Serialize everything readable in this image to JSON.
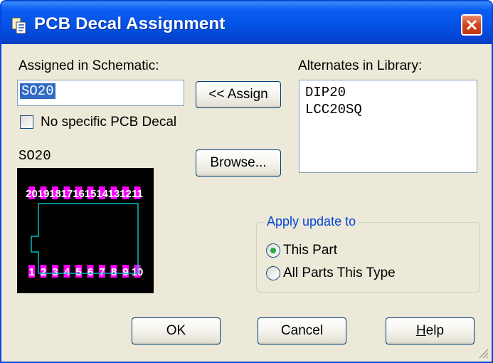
{
  "window": {
    "title": "PCB Decal Assignment",
    "close_label": "✕"
  },
  "assigned": {
    "label": "Assigned in Schematic:",
    "value": "SO20",
    "no_decal_label": "No specific PCB Decal",
    "no_decal_checked": false
  },
  "buttons": {
    "assign": "<< Assign",
    "browse": "Browse...",
    "ok": "OK",
    "cancel": "Cancel",
    "help_underlined": "H",
    "help_rest": "elp"
  },
  "preview": {
    "name": "SO20",
    "top_labels": [
      "20",
      "19",
      "18",
      "17",
      "16",
      "15",
      "14",
      "13",
      "12",
      "11"
    ],
    "bottom_labels": [
      "1",
      "2",
      "3",
      "4",
      "5",
      "6",
      "7",
      "8",
      "9",
      "10"
    ],
    "pad_color": "#ff00ff",
    "outline_color": "#00c0c0",
    "background": "#000000"
  },
  "alternates": {
    "label": "Alternates in Library:",
    "items": [
      "DIP20",
      "LCC20SQ"
    ]
  },
  "apply_update": {
    "legend": "Apply update to",
    "options": [
      {
        "label": "This Part",
        "selected": true
      },
      {
        "label": "All Parts This Type",
        "selected": false
      }
    ]
  },
  "colors": {
    "titlebar": "#0453e6",
    "dialog_bg": "#ece9d8",
    "legend": "#0046d5",
    "selection": "#316ac5"
  }
}
